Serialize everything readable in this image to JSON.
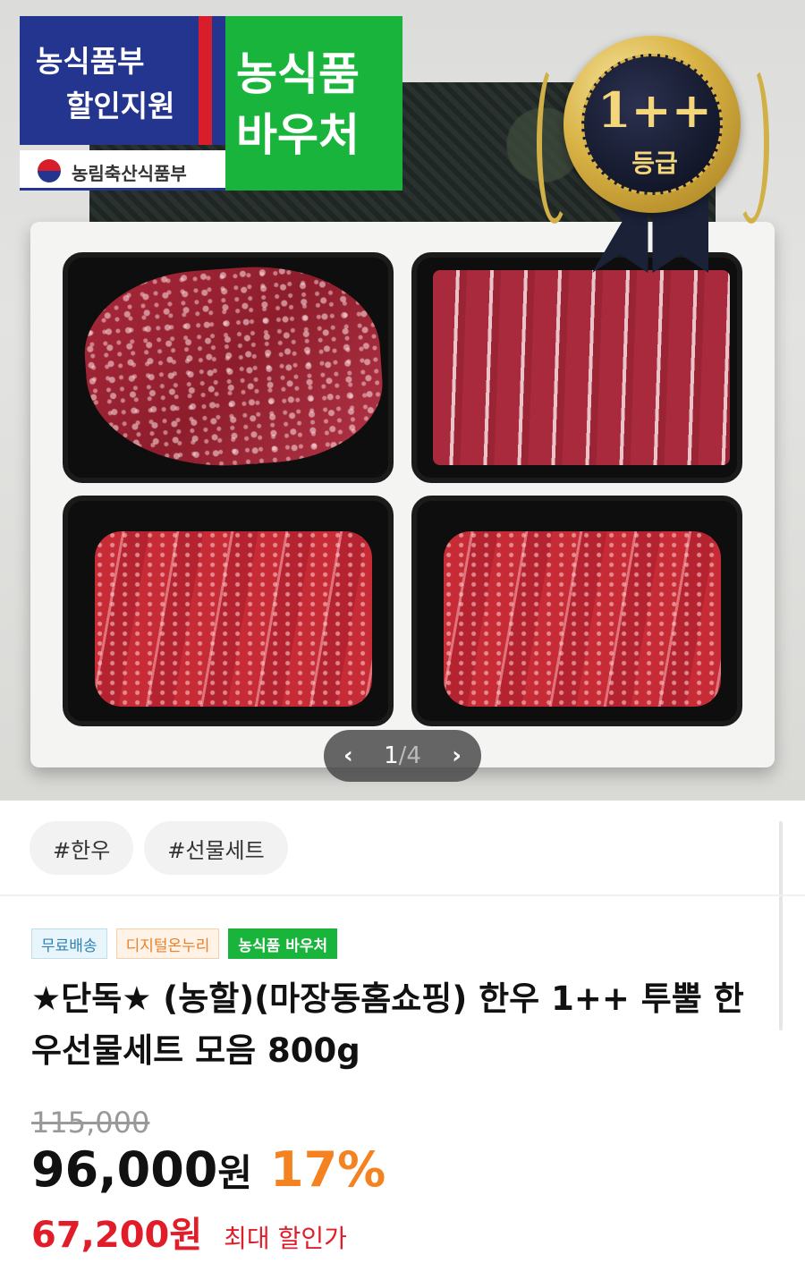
{
  "hero": {
    "gov_badge": {
      "line1": "농식품부",
      "line2": "할인지원",
      "ministry": "농림축산식품부"
    },
    "voucher_badge": {
      "line1": "농식품",
      "line2": "바우처"
    },
    "grade_medal": {
      "grade": "1++",
      "label": "등급"
    },
    "pager": {
      "prev": "‹",
      "current": "1",
      "separator": "/",
      "total": "4",
      "next": "›"
    }
  },
  "tags": [
    "#한우",
    "#선물세트"
  ],
  "labels": {
    "free_shipping": "무료배송",
    "digital": "디지털온누리",
    "voucher": "농식품 바우처"
  },
  "product": {
    "title": "★단독★ (농할)(마장동홈쇼핑) 한우 1++ 투뿔 한우선물세트 모음 800g",
    "original_price": "115,000",
    "sale_price": "96,000",
    "currency": "원",
    "discount_rate": "17%",
    "max_discount_price": "67,200원",
    "max_discount_label": "최대 할인가"
  },
  "colors": {
    "accent_orange": "#f58220",
    "red": "#e11d2a",
    "voucher_green": "#19b43c",
    "gov_blue": "#24358f"
  }
}
